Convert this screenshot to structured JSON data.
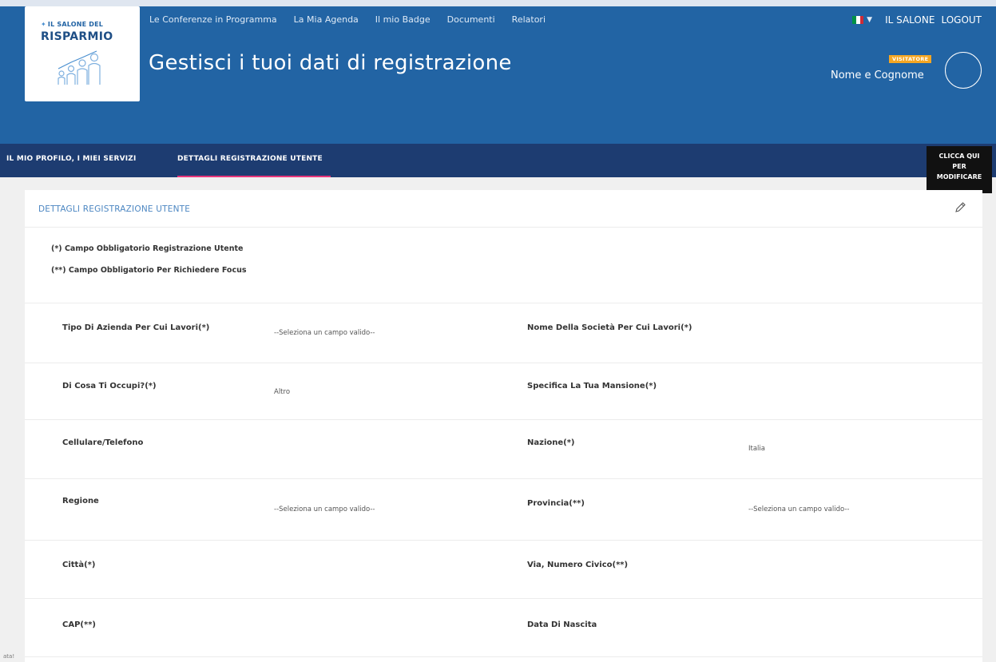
{
  "header": {
    "logo": {
      "top": "IL SALONE DEL",
      "main": "RISPARMIO"
    },
    "nav": [
      "Le Conferenze in Programma",
      "La Mia Agenda",
      "Il mio Badge",
      "Documenti",
      "Relatori"
    ],
    "title": "Gestisci i tuoi dati di registrazione",
    "right_links": {
      "salone": "IL SALONE",
      "logout": "LOGOUT"
    },
    "badge": "VISITATORE",
    "user_name": "Nome e Cognome"
  },
  "subnav": {
    "items": [
      "IL MIO PROFILO, I MIEI SERVIZI",
      "DETTAGLI REGISTRAZIONE UTENTE"
    ],
    "active_index": 1
  },
  "tooltip": [
    "CLICCA QUI",
    "PER",
    "MODIFICARE"
  ],
  "card": {
    "title": "DETTAGLI REGISTRAZIONE UTENTE",
    "notes": [
      "(*) Campo Obbligatorio Registrazione Utente",
      "(**) Campo Obbligatorio Per Richiedere Focus"
    ],
    "rows": [
      {
        "left_label": "Tipo Di Azienda Per Cui Lavori(*)",
        "left_value": "--Seleziona un campo valido--",
        "right_label": "Nome Della Società Per Cui Lavori(*)",
        "right_value": ""
      },
      {
        "left_label": "Di Cosa Ti Occupi?(*)",
        "left_value": "Altro",
        "right_label": "Specifica La Tua Mansione(*)",
        "right_value": ""
      },
      {
        "left_label": "Cellulare/Telefono",
        "left_value": "",
        "right_label": "Nazione(*)",
        "right_value": "Italia"
      },
      {
        "left_label": "Regione",
        "left_value": "--Seleziona un campo valido--",
        "right_label": "Provincia(**)",
        "right_value": "--Seleziona un campo valido--"
      },
      {
        "left_label": "Città(*)",
        "left_value": "",
        "right_label": "Via, Numero Civico(**)",
        "right_value": ""
      },
      {
        "left_label": "CAP(**)",
        "left_value": "",
        "right_label": "Data Di Nascita",
        "right_value": ""
      }
    ]
  },
  "colors": {
    "header": "#2264a4",
    "subnav": "#1d3c71",
    "accent": "#e8347a",
    "badge": "#f5a623",
    "link": "#4d87c2"
  },
  "icons": {
    "edit": "pencil-icon",
    "language": "italy-flag-icon",
    "avatar": "user-avatar"
  },
  "corner_text": "ata!"
}
